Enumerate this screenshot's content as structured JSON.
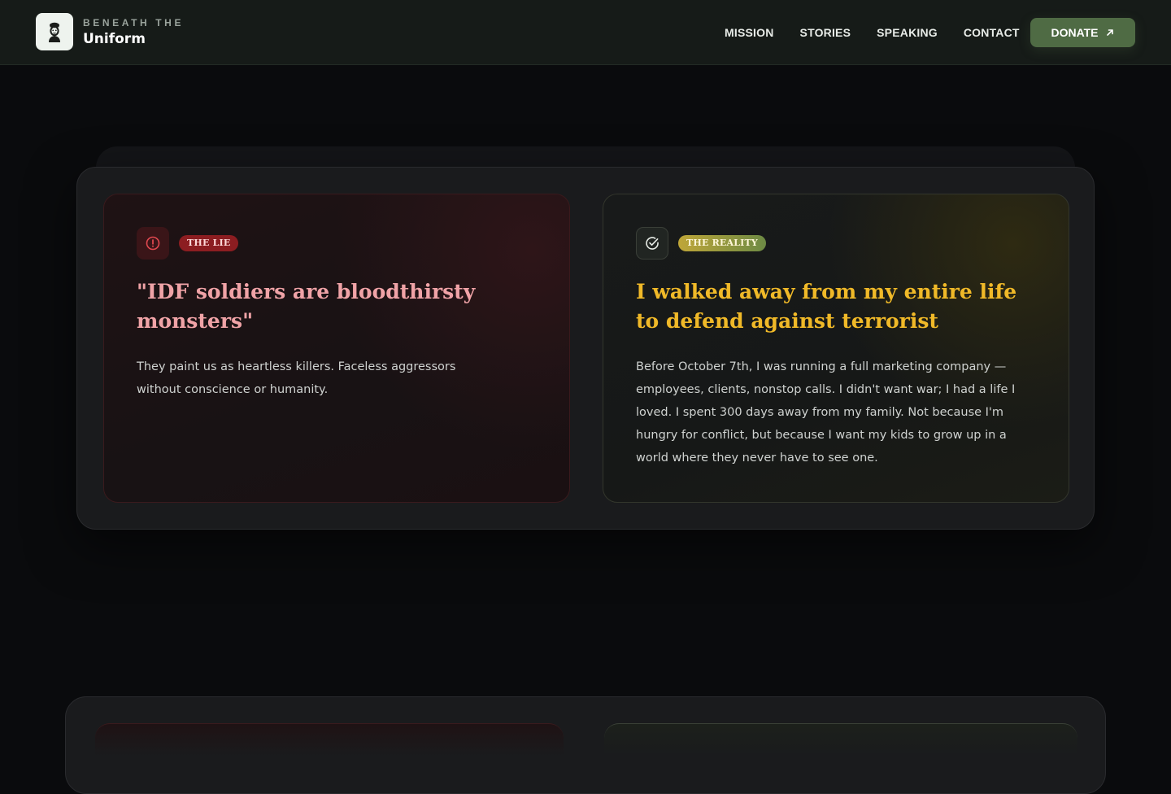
{
  "brand": {
    "kicker": "BENEATH THE",
    "name": "Uniform",
    "logo_icon": "soldier-bust-icon"
  },
  "nav": {
    "items": [
      "MISSION",
      "STORIES",
      "SPEAKING",
      "CONTACT"
    ],
    "donate_label": "DONATE",
    "donate_icon": "arrow-up-right-icon"
  },
  "comparison": {
    "lie": {
      "icon": "alert-circle-icon",
      "tag": "THE LIE",
      "heading": "\"IDF soldiers are bloodthirsty monsters\"",
      "body": "They paint us as heartless killers. Faceless aggressors without conscience or humanity."
    },
    "reality": {
      "icon": "check-circle-icon",
      "tag": "THE REALITY",
      "heading": "I walked away from my entire life to defend against terrorist",
      "body": "Before October 7th, I was running a full marketing company — employees, clients, nonstop calls. I didn't want war; I had a life I loved. I spent 300 days away from my family. Not because I'm hungry for conflict, but because I want my kids to grow up in a world where they never have to see one."
    }
  },
  "colors": {
    "background": "#0a0b0d",
    "header": "#161b18",
    "donate": "#4f6b44",
    "lie_accent": "#f0a3a7",
    "lie_tag": "#8c1d21",
    "reality_accent": "#f0b928"
  }
}
